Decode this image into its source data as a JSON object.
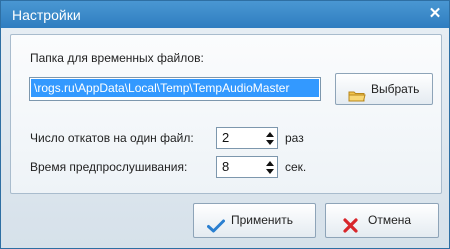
{
  "window": {
    "title": "Настройки",
    "close_glyph": "✕"
  },
  "temp_folder": {
    "label": "Папка для временных файлов:",
    "path_value": "rogs.ru\\AppData\\Local\\Temp\\TempAudioMaster\\",
    "browse_label": "Выбрать",
    "browse_icon": "folder-icon"
  },
  "undo": {
    "label": "Число откатов на один файл:",
    "value": "2",
    "unit": "раз"
  },
  "preview": {
    "label": "Время предпрослушивания:",
    "value": "8",
    "unit": "сек."
  },
  "buttons": {
    "apply_label": "Применить",
    "apply_icon": "checkmark-icon",
    "cancel_label": "Отмена",
    "cancel_icon": "cross-icon"
  },
  "colors": {
    "titlebar": "#3a8ac9",
    "selection": "#3399ff",
    "apply_check": "#2a7fd0",
    "cancel_x": "#d8262b"
  }
}
